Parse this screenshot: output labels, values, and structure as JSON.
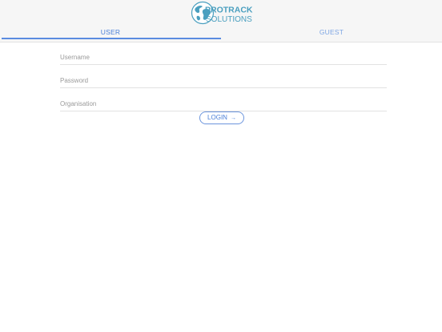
{
  "brand": {
    "line1": "PROTRACK",
    "line2": "SOLUTIONS",
    "primary_color": "#5b8ce0",
    "logo_color": "#4a9fbf"
  },
  "tabs": [
    {
      "label": "USER",
      "active": true
    },
    {
      "label": "GUEST",
      "active": false
    }
  ],
  "form": {
    "username": {
      "placeholder": "Username",
      "value": ""
    },
    "password": {
      "placeholder": "Password",
      "value": ""
    },
    "organisation": {
      "placeholder": "Organisation",
      "value": ""
    },
    "login_label": "LOGIN",
    "login_icon": "arrow-right-icon"
  }
}
